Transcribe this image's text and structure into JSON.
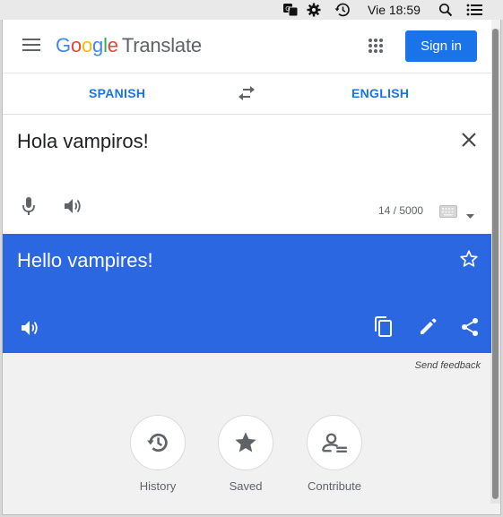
{
  "menubar": {
    "clock": "Vie 18:59",
    "icons": [
      "translate-icon",
      "gear-icon",
      "time-machine-icon",
      "spotlight-search-icon",
      "notification-center-icon"
    ]
  },
  "header": {
    "logo_google": "Google",
    "logo_product": "Translate",
    "signin_label": "Sign in",
    "icons": [
      "hamburger-menu-icon",
      "apps-grid-icon"
    ]
  },
  "languages": {
    "source": "SPANISH",
    "target": "ENGLISH",
    "swap_icon": "swap-arrows-icon"
  },
  "source": {
    "text": "Hola vampiros!",
    "char_count": "14 / 5000",
    "icons": [
      "clear-icon",
      "microphone-icon",
      "speaker-icon",
      "keyboard-icon",
      "dropdown-arrow-icon"
    ]
  },
  "result": {
    "text": "Hello vampires!",
    "icons": [
      "star-icon",
      "speaker-icon",
      "copy-icon",
      "edit-pencil-icon",
      "share-icon"
    ],
    "background": "#2b67e0"
  },
  "feedback_label": "Send feedback",
  "actions": [
    {
      "label": "History",
      "icon": "history-icon"
    },
    {
      "label": "Saved",
      "icon": "star-icon"
    },
    {
      "label": "Contribute",
      "icon": "contribute-icon"
    }
  ],
  "colors": {
    "accent": "#1a73e8",
    "result_bg": "#2b67e0"
  }
}
